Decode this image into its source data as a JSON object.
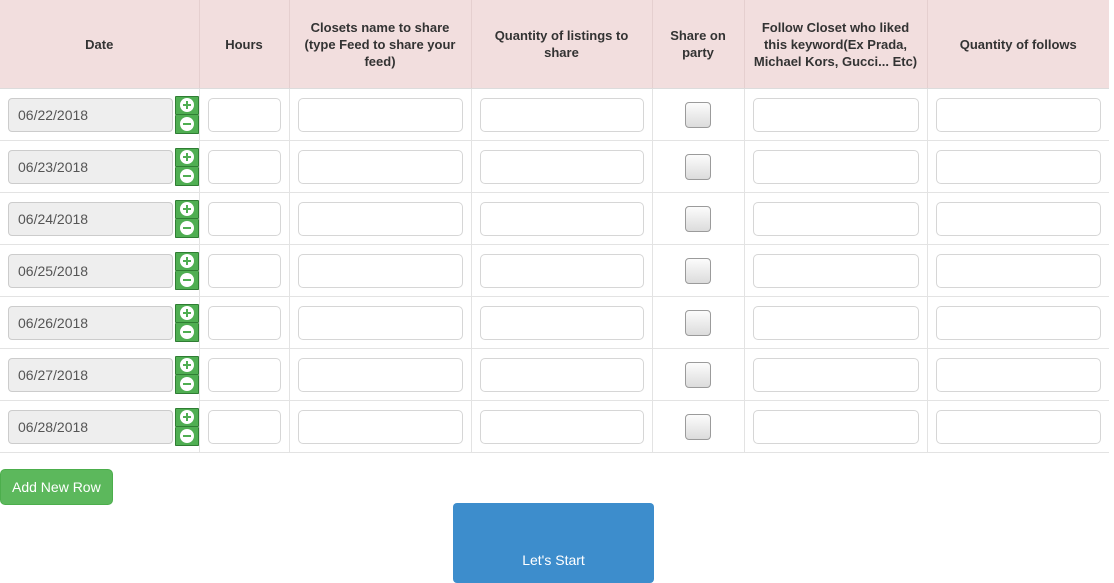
{
  "table": {
    "columns": [
      {
        "key": "date",
        "label": "Date"
      },
      {
        "key": "hours",
        "label": "Hours"
      },
      {
        "key": "closets",
        "label": "Closets name to share (type Feed to share your feed)"
      },
      {
        "key": "qty_list",
        "label": "Quantity of listings to share"
      },
      {
        "key": "party",
        "label": "Share on party"
      },
      {
        "key": "follow",
        "label": "Follow Closet who liked this keyword(Ex Prada, Michael Kors, Gucci... Etc)"
      },
      {
        "key": "qty_foll",
        "label": "Quantity of follows"
      }
    ],
    "rows": [
      {
        "date": "06/22/2018",
        "hours": "",
        "closets": "",
        "qty_list": "",
        "party_checked": false,
        "follow": "",
        "qty_foll": ""
      },
      {
        "date": "06/23/2018",
        "hours": "",
        "closets": "",
        "qty_list": "",
        "party_checked": false,
        "follow": "",
        "qty_foll": ""
      },
      {
        "date": "06/24/2018",
        "hours": "",
        "closets": "",
        "qty_list": "",
        "party_checked": false,
        "follow": "",
        "qty_foll": ""
      },
      {
        "date": "06/25/2018",
        "hours": "",
        "closets": "",
        "qty_list": "",
        "party_checked": false,
        "follow": "",
        "qty_foll": ""
      },
      {
        "date": "06/26/2018",
        "hours": "",
        "closets": "",
        "qty_list": "",
        "party_checked": false,
        "follow": "",
        "qty_foll": ""
      },
      {
        "date": "06/27/2018",
        "hours": "",
        "closets": "",
        "qty_list": "",
        "party_checked": false,
        "follow": "",
        "qty_foll": ""
      },
      {
        "date": "06/28/2018",
        "hours": "",
        "closets": "",
        "qty_list": "",
        "party_checked": false,
        "follow": "",
        "qty_foll": ""
      }
    ],
    "stepper": {
      "increment_icon": "plus-circle-icon",
      "decrement_icon": "minus-circle-icon"
    }
  },
  "actions": {
    "add_row_label": "Add New Row",
    "start_label": "Let's Start"
  },
  "colors": {
    "header_background": "#f2dede",
    "add_row_button": "#5cb85c",
    "start_button": "#3d8dcc",
    "stepper_button": "#4fae52",
    "date_field_background": "#eeeeee"
  }
}
